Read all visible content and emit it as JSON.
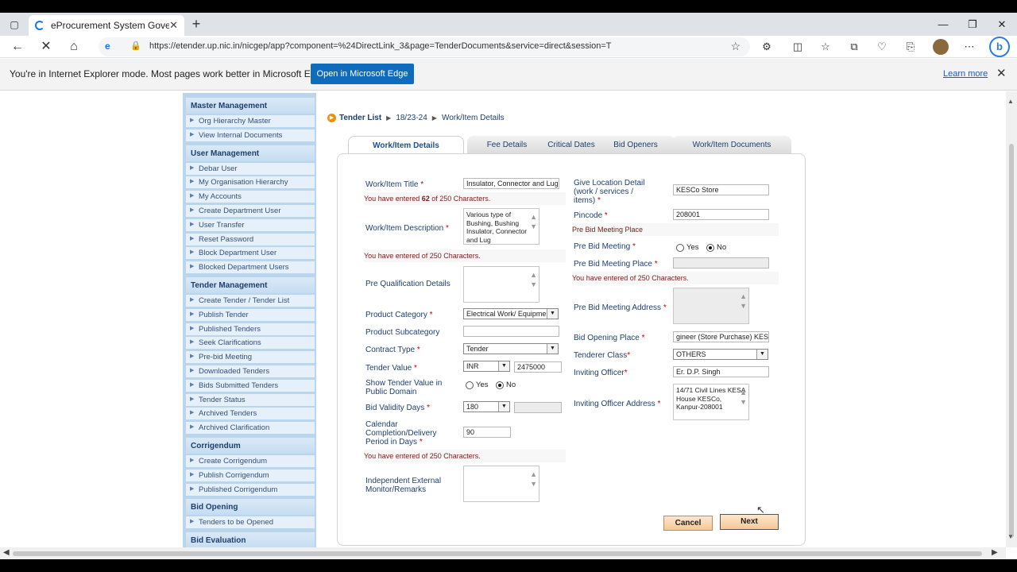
{
  "browser": {
    "tab_title": "eProcurement System Governme",
    "url": "https://etender.up.nic.in/nicgep/app?component=%24DirectLink_3&page=TenderDocuments&service=direct&session=T",
    "ie_mode_message": "You're in Internet Explorer mode. Most pages work better in Microsoft Edge.",
    "open_edge_label": "Open in Microsoft Edge",
    "learn_more_label": "Learn more",
    "bing_label": "b"
  },
  "sidebar": {
    "sections": [
      {
        "title": "Master Management",
        "items": [
          "Org Hierarchy Master",
          "View Internal Documents"
        ]
      },
      {
        "title": "User Management",
        "items": [
          "Debar User",
          "My Organisation Hierarchy",
          "My Accounts",
          "Create Department User",
          "User Transfer",
          "Reset Password",
          "Block Department User",
          "Blocked Department Users"
        ]
      },
      {
        "title": "Tender Management",
        "items": [
          "Create Tender / Tender List",
          "Publish Tender",
          "Published Tenders",
          "Seek Clarifications",
          "Pre-bid Meeting",
          "Downloaded Tenders",
          "Bids Submitted Tenders",
          "Tender Status",
          "Archived Tenders",
          "Archived Clarification"
        ]
      },
      {
        "title": "Corrigendum",
        "items": [
          "Create Corrigendum",
          "Publish Corrigendum",
          "Published Corrigendum"
        ]
      },
      {
        "title": "Bid Opening",
        "items": [
          "Tenders to be Opened"
        ]
      },
      {
        "title": "Bid Evaluation",
        "items": []
      }
    ]
  },
  "breadcrumb": {
    "root": "Tender List",
    "mid": "18/23-24",
    "current": "Work/Item Details"
  },
  "tabs": [
    "Work/Item Details",
    "Fee Details",
    "Critical Dates",
    "Bid Openers",
    "Work/Item Documents"
  ],
  "form": {
    "title_label": "Work/Item Title",
    "title_value": "Insulator, Connector and Lug",
    "title_note_pre": "You have entered ",
    "title_note_count": "62",
    "title_note_post": " of 250 Characters.",
    "desc_label": "Work/Item Description",
    "desc_value": "Various type of Bushing, Bushing Insulator, Connector and Lug",
    "desc_note": "You have entered    of 250  Characters.",
    "preq_label": "Pre Qualification Details",
    "prodcat_label": "Product Category",
    "prodcat_value": "Electrical Work/ Equipmen",
    "prodsub_label": "Product Subcategory",
    "contract_label": "Contract Type",
    "contract_value": "Tender",
    "tvalue_label": "Tender Value",
    "currency_value": "INR",
    "tvalue_value": "2475000",
    "show_label_1": "Show Tender Value in",
    "show_label_2": "Public Domain",
    "yes": "Yes",
    "no": "No",
    "validity_label": "Bid Validity Days",
    "validity_value": "180",
    "period_label_1": "Calendar",
    "period_label_2": "Completion/Delivery",
    "period_label_3": "Period in Days",
    "period_value": "90",
    "period_note": "You have entered    of 250  Characters.",
    "monitor_label_1": "Independent External",
    "monitor_label_2": "Monitor/Remarks",
    "loc_label_1": "Give Location Detail",
    "loc_label_2": "(work / services /",
    "loc_label_3": "items)",
    "loc_value": "KESCo Store",
    "pin_label": "Pincode",
    "pin_value": "208001",
    "prebid_place_note": "Pre Bid Meeting Place",
    "prebid_label": "Pre Bid Meeting",
    "prebid_place_label": "Pre Bid Meeting Place",
    "prebid_place_count_note": "You have entered    of 250 Characters.",
    "prebid_addr_label": "Pre Bid Meeting Address",
    "bidopen_label": "Bid Opening Place",
    "bidopen_value": "gineer (Store Purchase) KESCo",
    "tclass_label": "Tenderer Class",
    "tclass_value": "OTHERS",
    "officer_label": "Inviting Officer",
    "officer_value": "Er. D.P. Singh",
    "officer_addr_label": "Inviting Officer Address",
    "officer_addr_value": "14/71 Civil Lines KESA House KESCo, Kanpur-208001"
  },
  "buttons": {
    "cancel": "Cancel",
    "next": "Next"
  },
  "colors": {
    "accent": "#0f6cbd",
    "sidebar_bg": "#b9d6ee",
    "section_title": "#1f3f6d",
    "note_red": "#7a1b1b"
  }
}
